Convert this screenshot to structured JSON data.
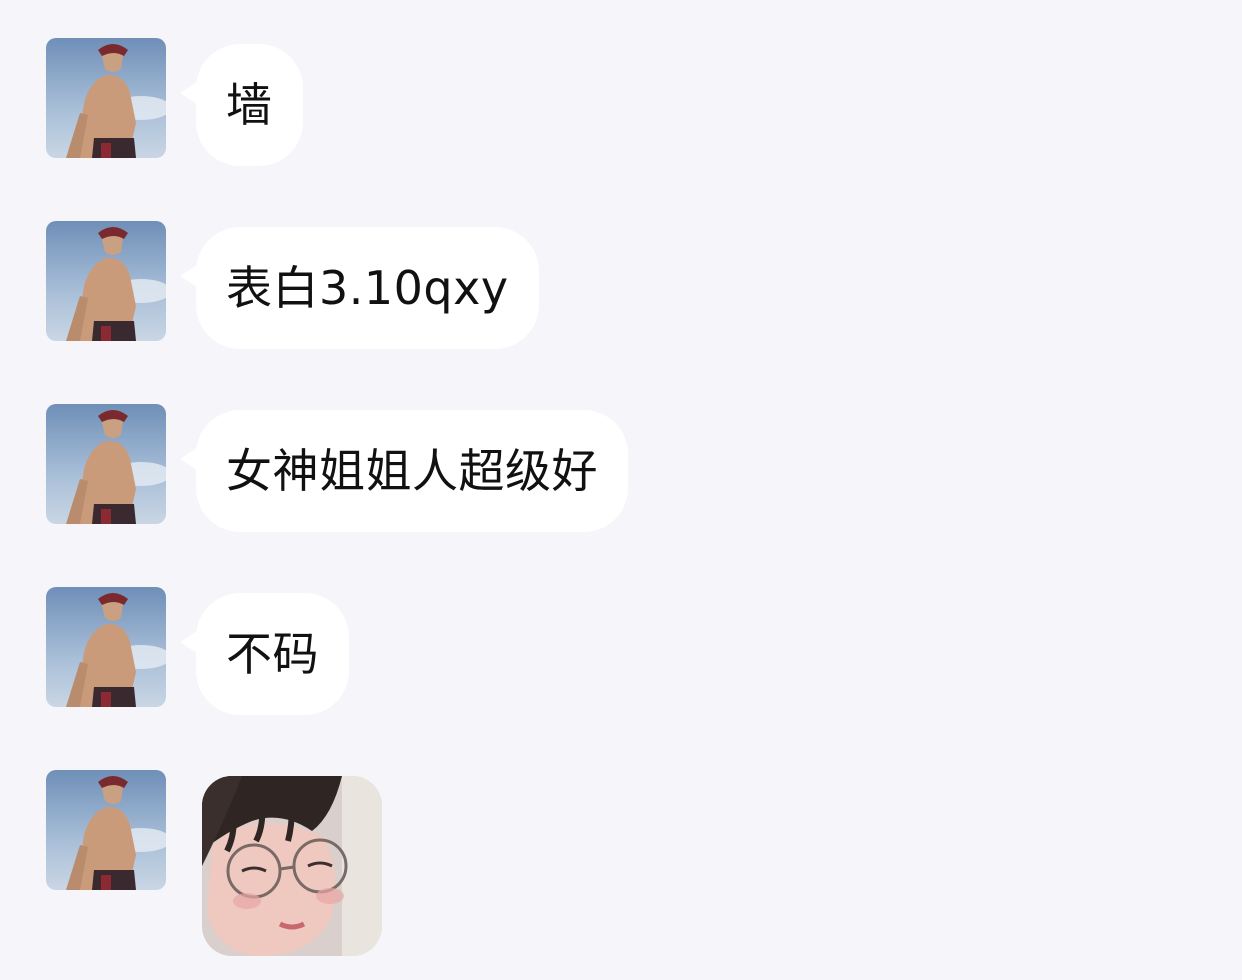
{
  "messages": [
    {
      "type": "text",
      "text": "墙"
    },
    {
      "type": "text",
      "text": "表白3.10qxy"
    },
    {
      "type": "text",
      "text": "女神姐姐人超级好"
    },
    {
      "type": "text",
      "text": "不码"
    },
    {
      "type": "sticker",
      "sticker": "crying-girl-with-glasses-sticker"
    }
  ],
  "colors": {
    "background": "#f5f5fa",
    "bubble": "#ffffff",
    "text": "#111111"
  }
}
